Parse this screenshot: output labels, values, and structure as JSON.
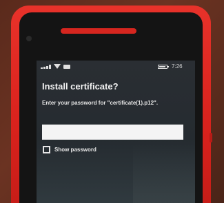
{
  "status_bar": {
    "time": "7:26",
    "icons": [
      "signal-icon",
      "wifi-icon",
      "battery-icon"
    ]
  },
  "dialog": {
    "title": "Install certificate?",
    "prompt": "Enter your password for \"certificate(1).p12\".",
    "password_value": "",
    "show_password_label": "Show password",
    "show_password_checked": false
  },
  "colors": {
    "phone_body": "#d9221d",
    "screen_background": "#2a2e33",
    "text": "#f2f2f2"
  }
}
